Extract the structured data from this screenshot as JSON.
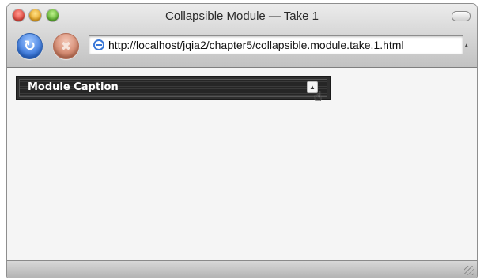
{
  "window": {
    "title": "Collapsible Module — Take 1"
  },
  "toolbar": {
    "url": "http://localhost/jqia2/chapter5/collapsible.module.take.1.html"
  },
  "module": {
    "caption": "Module Caption"
  }
}
